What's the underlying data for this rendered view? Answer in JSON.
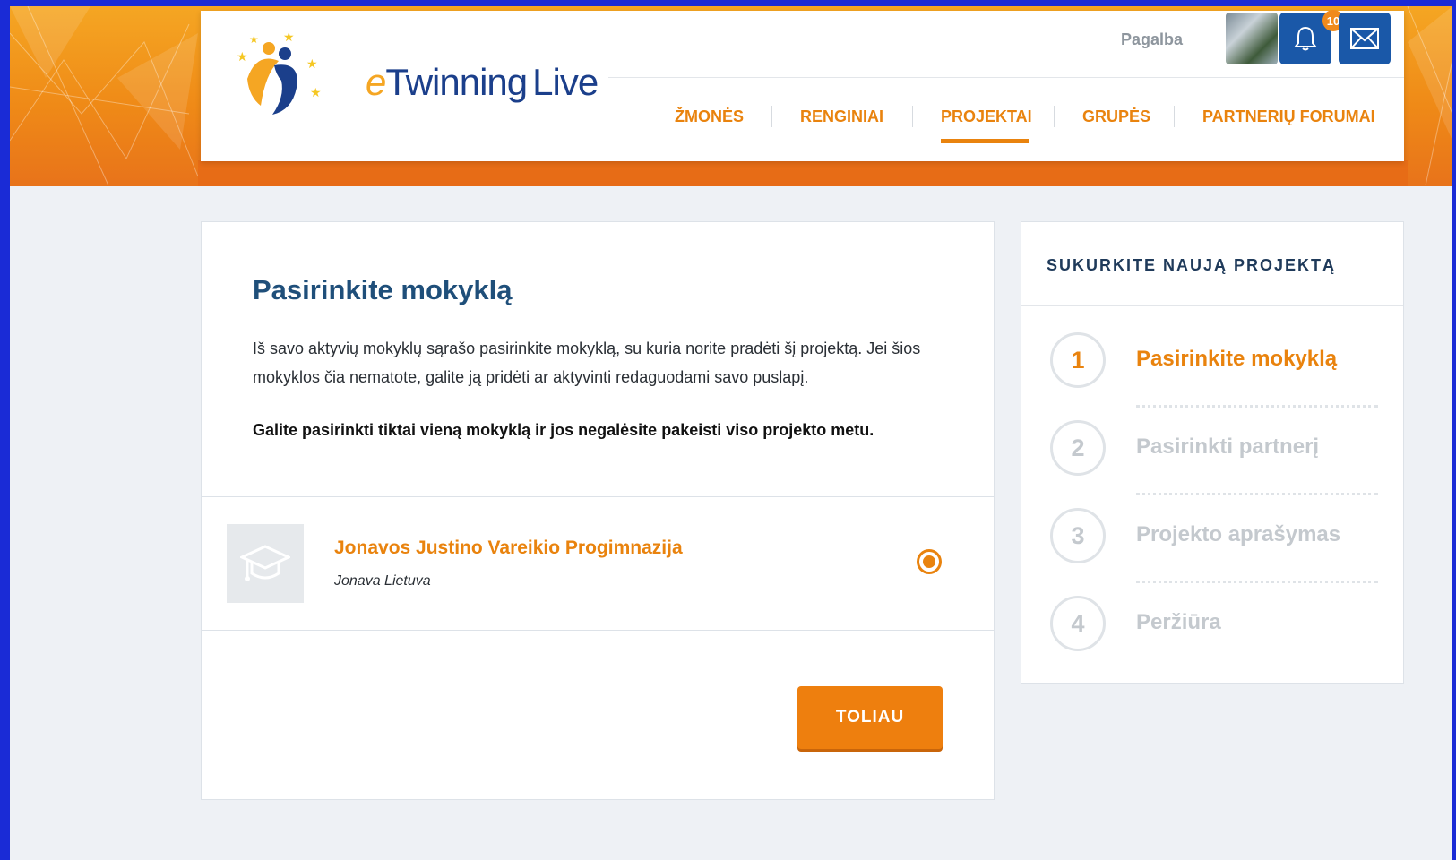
{
  "brand": {
    "logo_prefix": "e",
    "logo_main": "Twinning",
    "logo_suffix": "Live"
  },
  "header": {
    "help_label": "Pagalba",
    "notifications_count": "10",
    "nav": [
      {
        "label": "ŽMONĖS"
      },
      {
        "label": "RENGINIAI"
      },
      {
        "label": "PROJEKTAI",
        "active": true
      },
      {
        "label": "GRUPĖS"
      },
      {
        "label": "PARTNERIŲ FORUMAI"
      }
    ]
  },
  "main": {
    "title": "Pasirinkite mokyklą",
    "description": "Iš savo aktyvių mokyklų sąrašo pasirinkite mokyklą, su kuria norite pradėti šį projektą. Jei šios mokyklos čia nematote, galite ją pridėti ar aktyvinti redaguodami savo puslapį.",
    "note": "Galite pasirinkti tiktai vieną mokyklą ir jos negalėsite pakeisti viso projekto metu.",
    "school": {
      "name": "Jonavos Justino Vareikio Progimnazija",
      "location": "Jonava Lietuva",
      "selected": true
    },
    "next_label": "TOLIAU"
  },
  "sidebar": {
    "title": "SUKURKITE NAUJĄ PROJEKTĄ",
    "steps": [
      {
        "number": "1",
        "label": "Pasirinkite mokyklą",
        "active": true
      },
      {
        "number": "2",
        "label": "Pasirinkti partnerį",
        "active": false
      },
      {
        "number": "3",
        "label": "Projekto aprašymas",
        "active": false
      },
      {
        "number": "4",
        "label": "Peržiūra",
        "active": false
      }
    ]
  },
  "colors": {
    "accent": "#e9830e",
    "brand_blue": "#1b3f8b",
    "icon_button": "#1a58a8",
    "title_blue": "#1f4f7a"
  }
}
